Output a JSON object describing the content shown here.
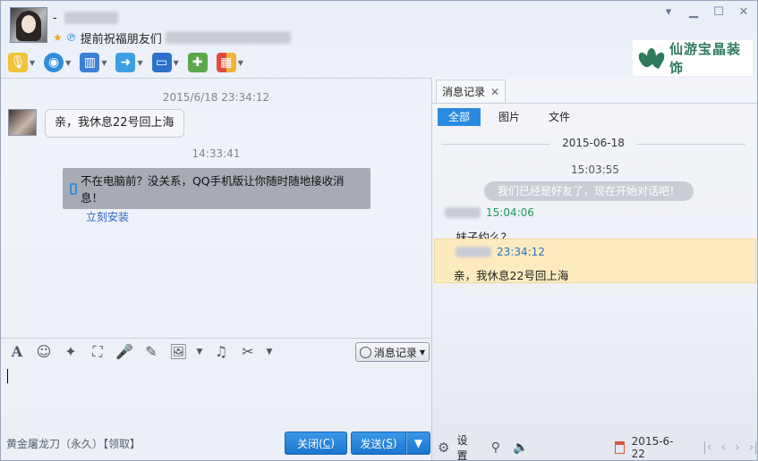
{
  "header": {
    "name_prefix": "-",
    "signature": "提前祝福朋友们",
    "brand_text": "仙游宝晶装饰"
  },
  "chat": {
    "timestamp1": "2015/6/18 23:34:12",
    "message1": "亲，我休息22号回上海",
    "timestamp2": "14:33:41",
    "notice_text": "不在电脑前？没关系，QQ手机版让你随时随地接收消息！",
    "notice_link": "立刻安装"
  },
  "input": {
    "history_label": "消息记录",
    "footer_text": "黄金屠龙刀（永久）【领取】",
    "close_label": "关闭(C)",
    "close_text": "关闭(",
    "close_key": "C",
    "close_end": ")",
    "send_text": "发送(",
    "send_key": "S",
    "send_end": ")"
  },
  "history_panel": {
    "tab_label": "消息记录",
    "filters": [
      "全部",
      "图片",
      "文件"
    ],
    "date_separator": "2015-06-18",
    "sys_time": "15:03:55",
    "sys_message": "我们已经是好友了，现在开始对话吧！",
    "entry1_time": "15:04:06",
    "entry1_text": "，妹子约么？",
    "entry2_time": "23:34:12",
    "entry2_text": "亲，我休息22号回上海",
    "settings_label": "设置",
    "bottom_date": "2015-6-22"
  },
  "colors": {
    "accent": "#2a8ae0",
    "highlight": "#fdebbf",
    "green_time": "#1e9b5c",
    "blue_time": "#2a6fc4"
  }
}
